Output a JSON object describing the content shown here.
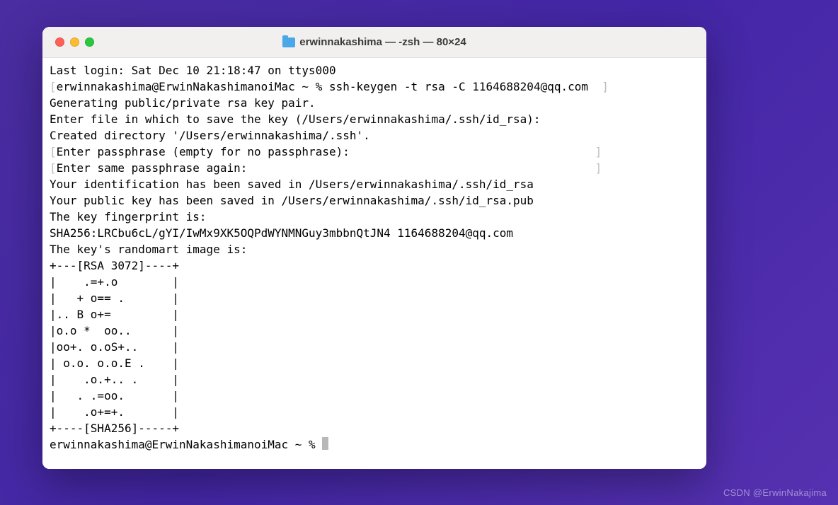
{
  "titlebar": {
    "title": "erwinnakashima — -zsh — 80×24"
  },
  "terminal": {
    "lines": [
      "Last login: Sat Dec 10 21:18:47 on ttys000",
      "[erwinnakashima@ErwinNakashimanoiMac ~ % ssh-keygen -t rsa -C 1164688204@qq.com  ]",
      "Generating public/private rsa key pair.",
      "Enter file in which to save the key (/Users/erwinnakashima/.ssh/id_rsa): ",
      "Created directory '/Users/erwinnakashima/.ssh'.",
      "[Enter passphrase (empty for no passphrase):                                    ]",
      "[Enter same passphrase again:                                                   ]",
      "Your identification has been saved in /Users/erwinnakashima/.ssh/id_rsa",
      "Your public key has been saved in /Users/erwinnakashima/.ssh/id_rsa.pub",
      "The key fingerprint is:",
      "SHA256:LRCbu6cL/gYI/IwMx9XK5OQPdWYNMNGuy3mbbnQtJN4 1164688204@qq.com",
      "The key's randomart image is:",
      "+---[RSA 3072]----+",
      "|    .=+.o        |",
      "|   + o== .       |",
      "|.. B o+=         |",
      "|o.o *  oo..      |",
      "|oo+. o.oS+..     |",
      "| o.o. o.o.E .    |",
      "|    .o.+.. .     |",
      "|   . .=oo.       |",
      "|    .o+=+.       |",
      "+----[SHA256]-----+",
      "erwinnakashima@ErwinNakashimanoiMac ~ % "
    ]
  },
  "watermark": "CSDN @ErwinNakajima"
}
